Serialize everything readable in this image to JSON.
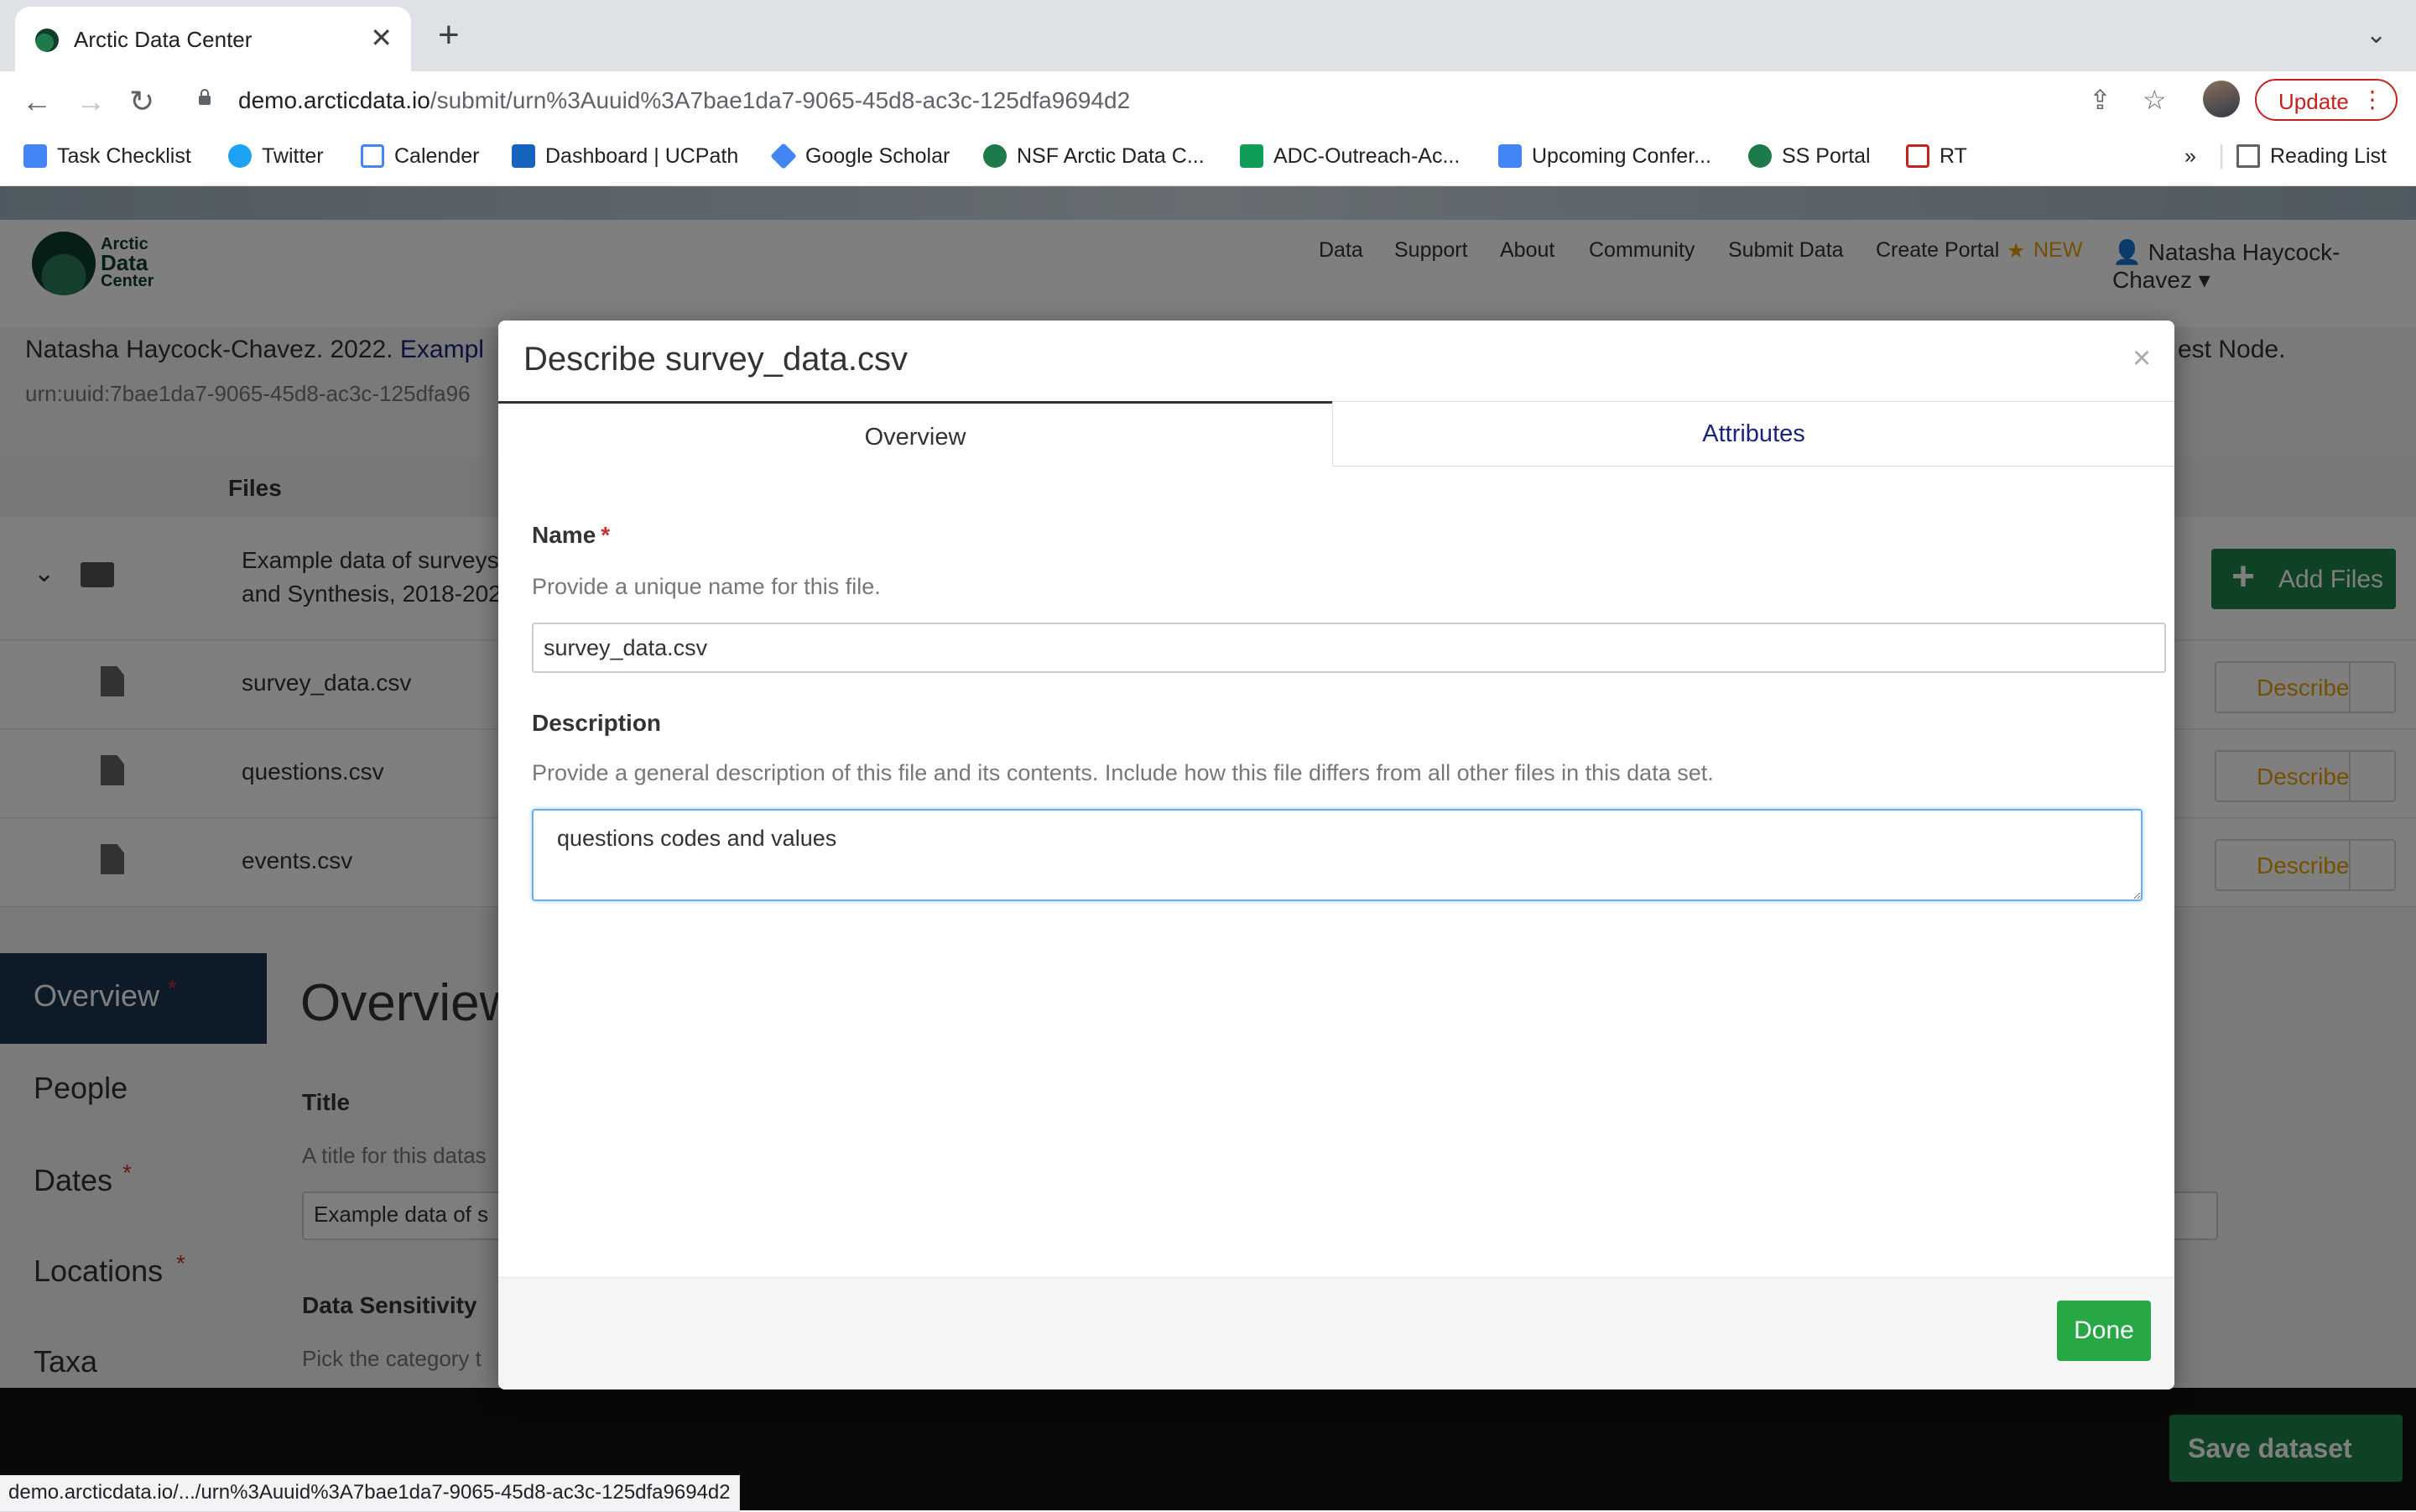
{
  "browser": {
    "tab_title": "Arctic Data Center",
    "new_tab": "+",
    "url_domain": "demo.arcticdata.io",
    "url_path": "/submit/urn%3Auuid%3A7bae1da7-9065-45d8-ac3c-125dfa9694d2",
    "update_label": "Update",
    "reading_list": "Reading List",
    "bookmarks": [
      "Task Checklist",
      "Twitter",
      "Calender",
      "Dashboard | UCPath",
      "Google Scholar",
      "NSF Arctic Data C...",
      "ADC-Outreach-Ac...",
      "Upcoming Confer...",
      "SS Portal",
      "RT"
    ],
    "more_bookmarks": "»",
    "status_url": "demo.arcticdata.io/.../urn%3Auuid%3A7bae1da7-9065-45d8-ac3c-125dfa9694d2"
  },
  "site": {
    "logo_lines": [
      "Arctic",
      "Data",
      "Center"
    ],
    "nav": [
      "Data",
      "Support",
      "About",
      "Community",
      "Submit Data",
      "Create Portal"
    ],
    "new_badge": "NEW",
    "user": "Natasha Haycock-Chavez",
    "citation_start": "Natasha Haycock-Chavez. 2022.",
    "citation_link": "Exampl",
    "citation_end": "est Node.",
    "identifier": "urn:uuid:7bae1da7-9065-45d8-ac3c-125dfa96",
    "files_header": "Files",
    "folder_name_1": "Example data of surveys",
    "folder_name_2": "and Synthesis, 2018-202",
    "add_files": "Add Files",
    "files": [
      "survey_data.csv",
      "questions.csv",
      "events.csv"
    ],
    "describe_label": "Describe",
    "sidebar": [
      "Overview",
      "People",
      "Dates",
      "Locations",
      "Taxa"
    ],
    "section_heading": "Overview",
    "title_label": "Title",
    "title_help": "A title for this datas",
    "title_value": "Example data of s",
    "sensitivity_label": "Data Sensitivity",
    "sensitivity_help": "Pick the category t",
    "save_dataset": "Save dataset"
  },
  "modal": {
    "title": "Describe survey_data.csv",
    "close": "×",
    "tabs": [
      "Overview",
      "Attributes"
    ],
    "name_label": "Name",
    "required_mark": "*",
    "name_help": "Provide a unique name for this file.",
    "name_value": "survey_data.csv",
    "description_label": "Description",
    "description_help": "Provide a general description of this file and its contents. Include how this file differs from all other files in this data set.",
    "description_value": "questions codes and values",
    "done": "Done"
  },
  "colors": {
    "accent_green": "#28a745",
    "required_red": "#c9302c",
    "focus_blue": "#66afe9"
  }
}
